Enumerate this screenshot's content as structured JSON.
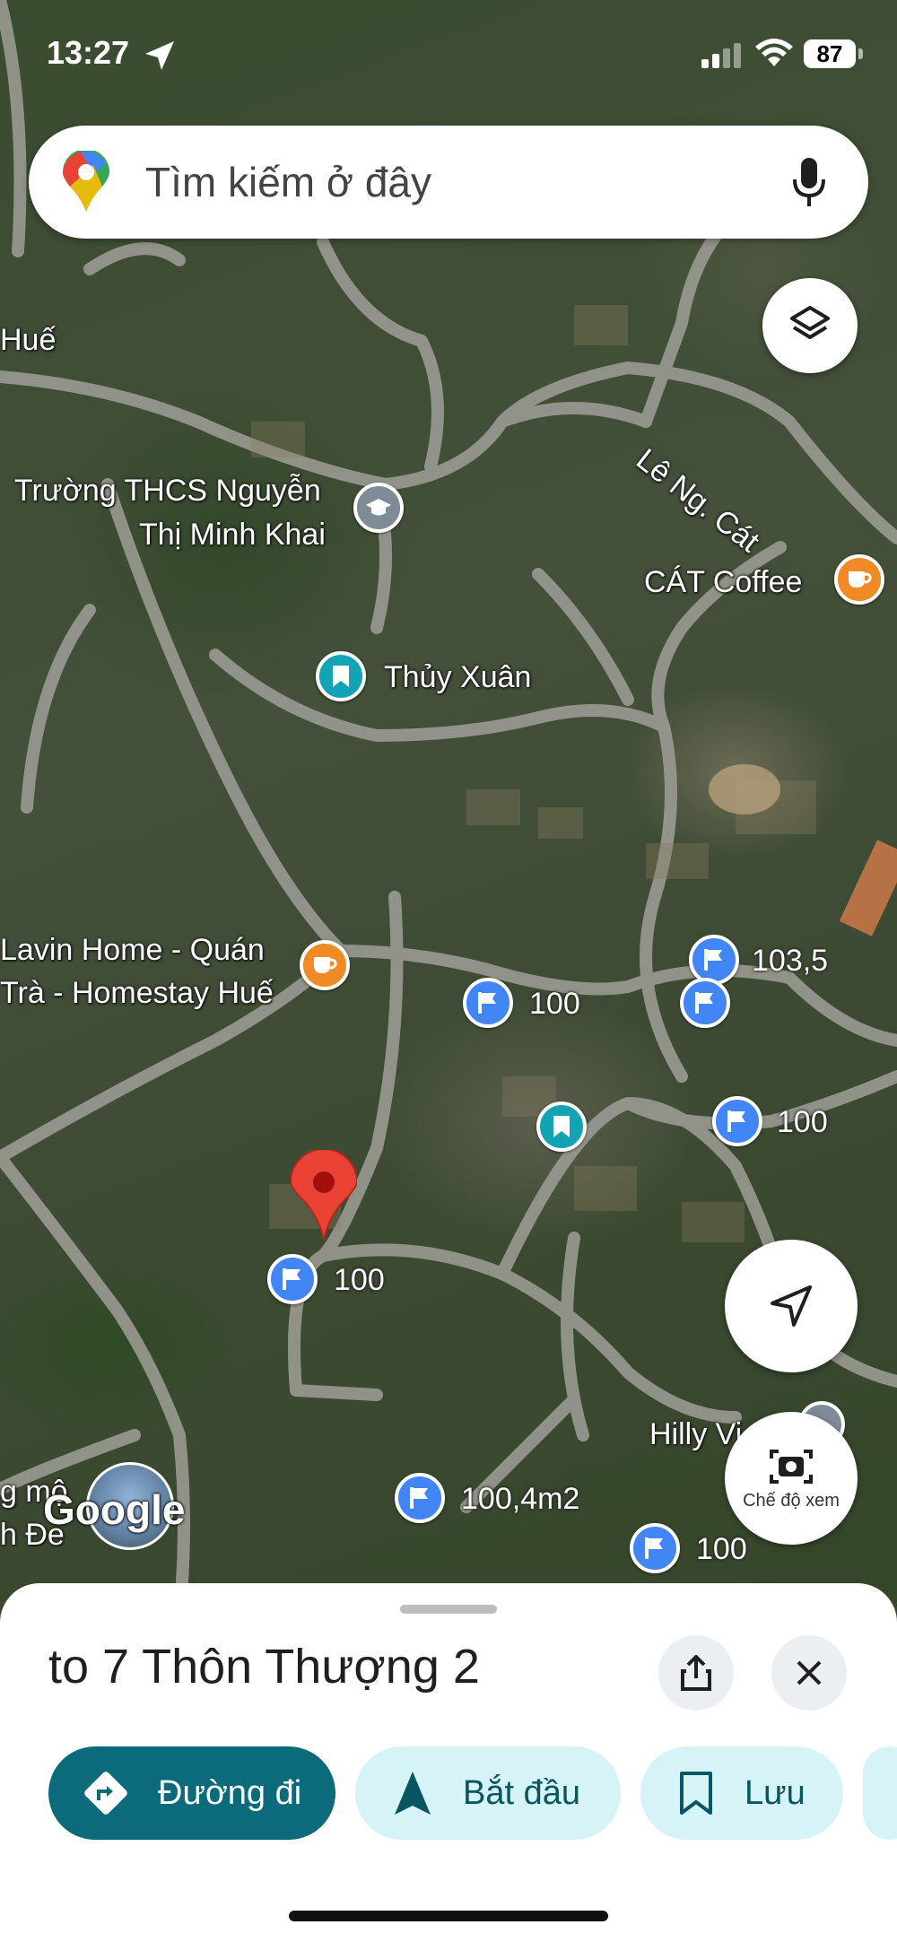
{
  "status_bar": {
    "time": "13:27",
    "battery": "87"
  },
  "search": {
    "placeholder": "Tìm kiếm ở đây"
  },
  "map": {
    "labels": {
      "hue": "Huế",
      "school_line1": "Trường THCS Nguyễn",
      "school_line2": "Thị Minh Khai",
      "le_ng_cat": "Lê Ng. Cát",
      "cat_coffee": "CÁT Coffee",
      "thuy_xuan": "Thủy Xuân",
      "lavin_line1": "Lavin Home - Quán",
      "lavin_line2": "Trà - Homestay Huế",
      "hilly": "Hilly Vi",
      "bottom_left1": "g mộ",
      "bottom_left2": "h Đe",
      "google": "Google"
    },
    "prices": {
      "p1": "103,5",
      "p2": "100",
      "p3": "100",
      "p4": "100",
      "p5": "100,4m2",
      "p6": "100"
    }
  },
  "view_mode": {
    "label": "Chế độ xem"
  },
  "sheet": {
    "title": "to 7 Thôn Thượng 2",
    "chips": [
      {
        "label": "Đường đi"
      },
      {
        "label": "Bắt đầu"
      },
      {
        "label": "Lưu"
      }
    ]
  },
  "colors": {
    "primary": "#0b6b7a",
    "secondary": "#d6f3f7",
    "pin_blue": "#4285f4",
    "pin_red": "#ea4335"
  }
}
